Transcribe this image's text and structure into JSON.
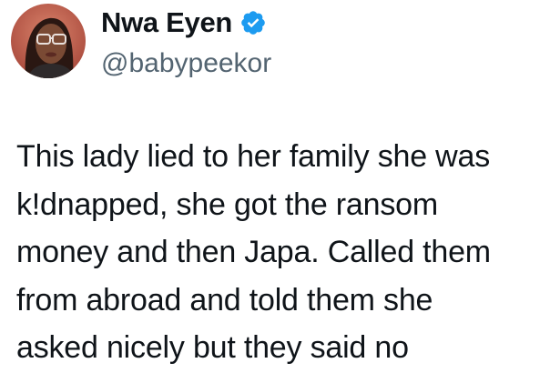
{
  "author": {
    "display_name": "Nwa Eyen",
    "handle": "@babypeekor",
    "avatar_icon": "profile-photo-avatar",
    "verified_icon": "verified-badge-icon",
    "verified_color": "#1d9bf0"
  },
  "tweet": {
    "lines": [
      "This lady lied to her family she was",
      "k!dnapped, she got the ransom",
      "money and then Japa. Called them",
      "from abroad and told them she",
      "asked nicely but they said no"
    ]
  },
  "colors": {
    "text_primary": "#0f1419",
    "text_secondary": "#536471",
    "background": "#ffffff"
  }
}
